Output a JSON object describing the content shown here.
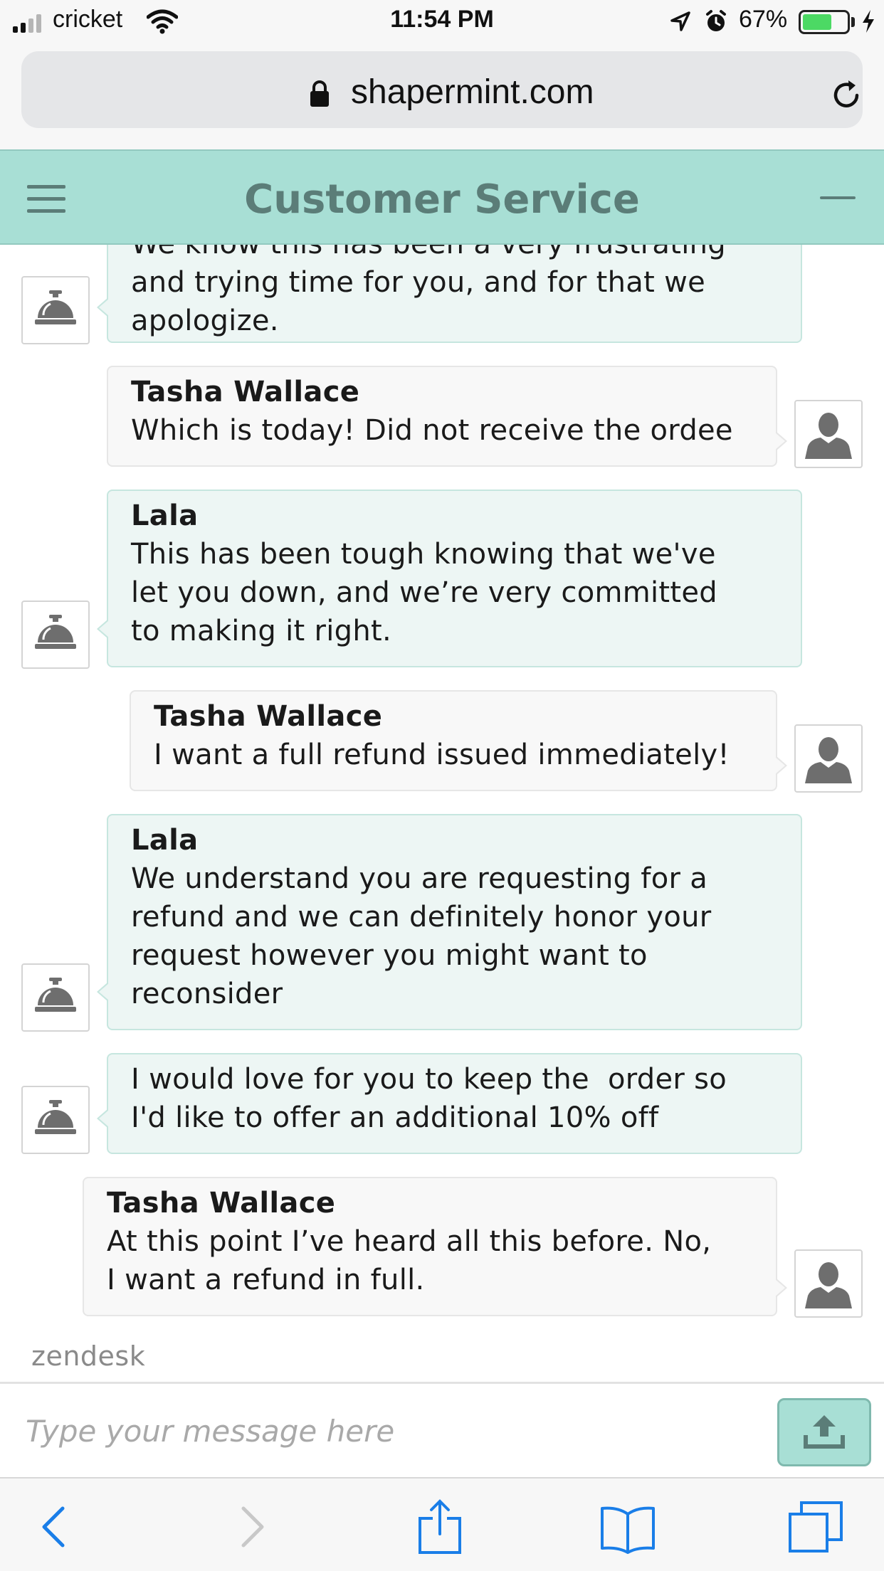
{
  "status_bar": {
    "carrier": "cricket",
    "time": "11:54 PM",
    "battery_percent": "67%",
    "battery_level": 0.67,
    "icons": [
      "signal-icon",
      "wifi-icon",
      "location-icon",
      "alarm-icon",
      "battery-icon",
      "charging-icon"
    ]
  },
  "browser": {
    "url": "shapermint.com",
    "icons": [
      "lock-icon",
      "reload-icon"
    ]
  },
  "chat_header": {
    "title": "Customer Service",
    "icons": [
      "menu-icon",
      "minimize-icon"
    ]
  },
  "messages": [
    {
      "sender": "agent",
      "name": "",
      "text": "We know this has been a very frustrating\nand trying time for you, and for that we\napologize."
    },
    {
      "sender": "user",
      "name": "Tasha Wallace",
      "text": "Which is today! Did not receive the ordee"
    },
    {
      "sender": "agent",
      "name": "Lala",
      "text": "This has been tough knowing that we've\nlet you down, and we’re very committed\nto making it right."
    },
    {
      "sender": "user",
      "name": "Tasha Wallace",
      "text": "I want a full refund issued immediately!"
    },
    {
      "sender": "agent",
      "name": "Lala",
      "text": "We understand you are requesting for a\nrefund and we can definitely honor your\nrequest however you might want to\nreconsider"
    },
    {
      "sender": "agent",
      "name": "",
      "text": "I would love for you to keep the  order so\nI'd like to offer an additional 10% off"
    },
    {
      "sender": "user",
      "name": "Tasha Wallace",
      "text": "At this point I’ve heard all this before. No,\nI want a refund in full."
    }
  ],
  "branding": {
    "powered_by": "zendesk"
  },
  "composer": {
    "placeholder": "Type your message here",
    "value": "",
    "send_icon": "upload-icon"
  },
  "toolbar": {
    "icons": [
      "back-icon",
      "forward-icon",
      "share-icon",
      "bookmarks-icon",
      "tabs-icon"
    ]
  },
  "colors": {
    "header_bg": "#a8dfd5",
    "header_text": "#5b7d78",
    "agent_bubble": "#edf6f4",
    "user_bubble": "#f8f8f8",
    "ios_blue": "#1a7ee8"
  }
}
